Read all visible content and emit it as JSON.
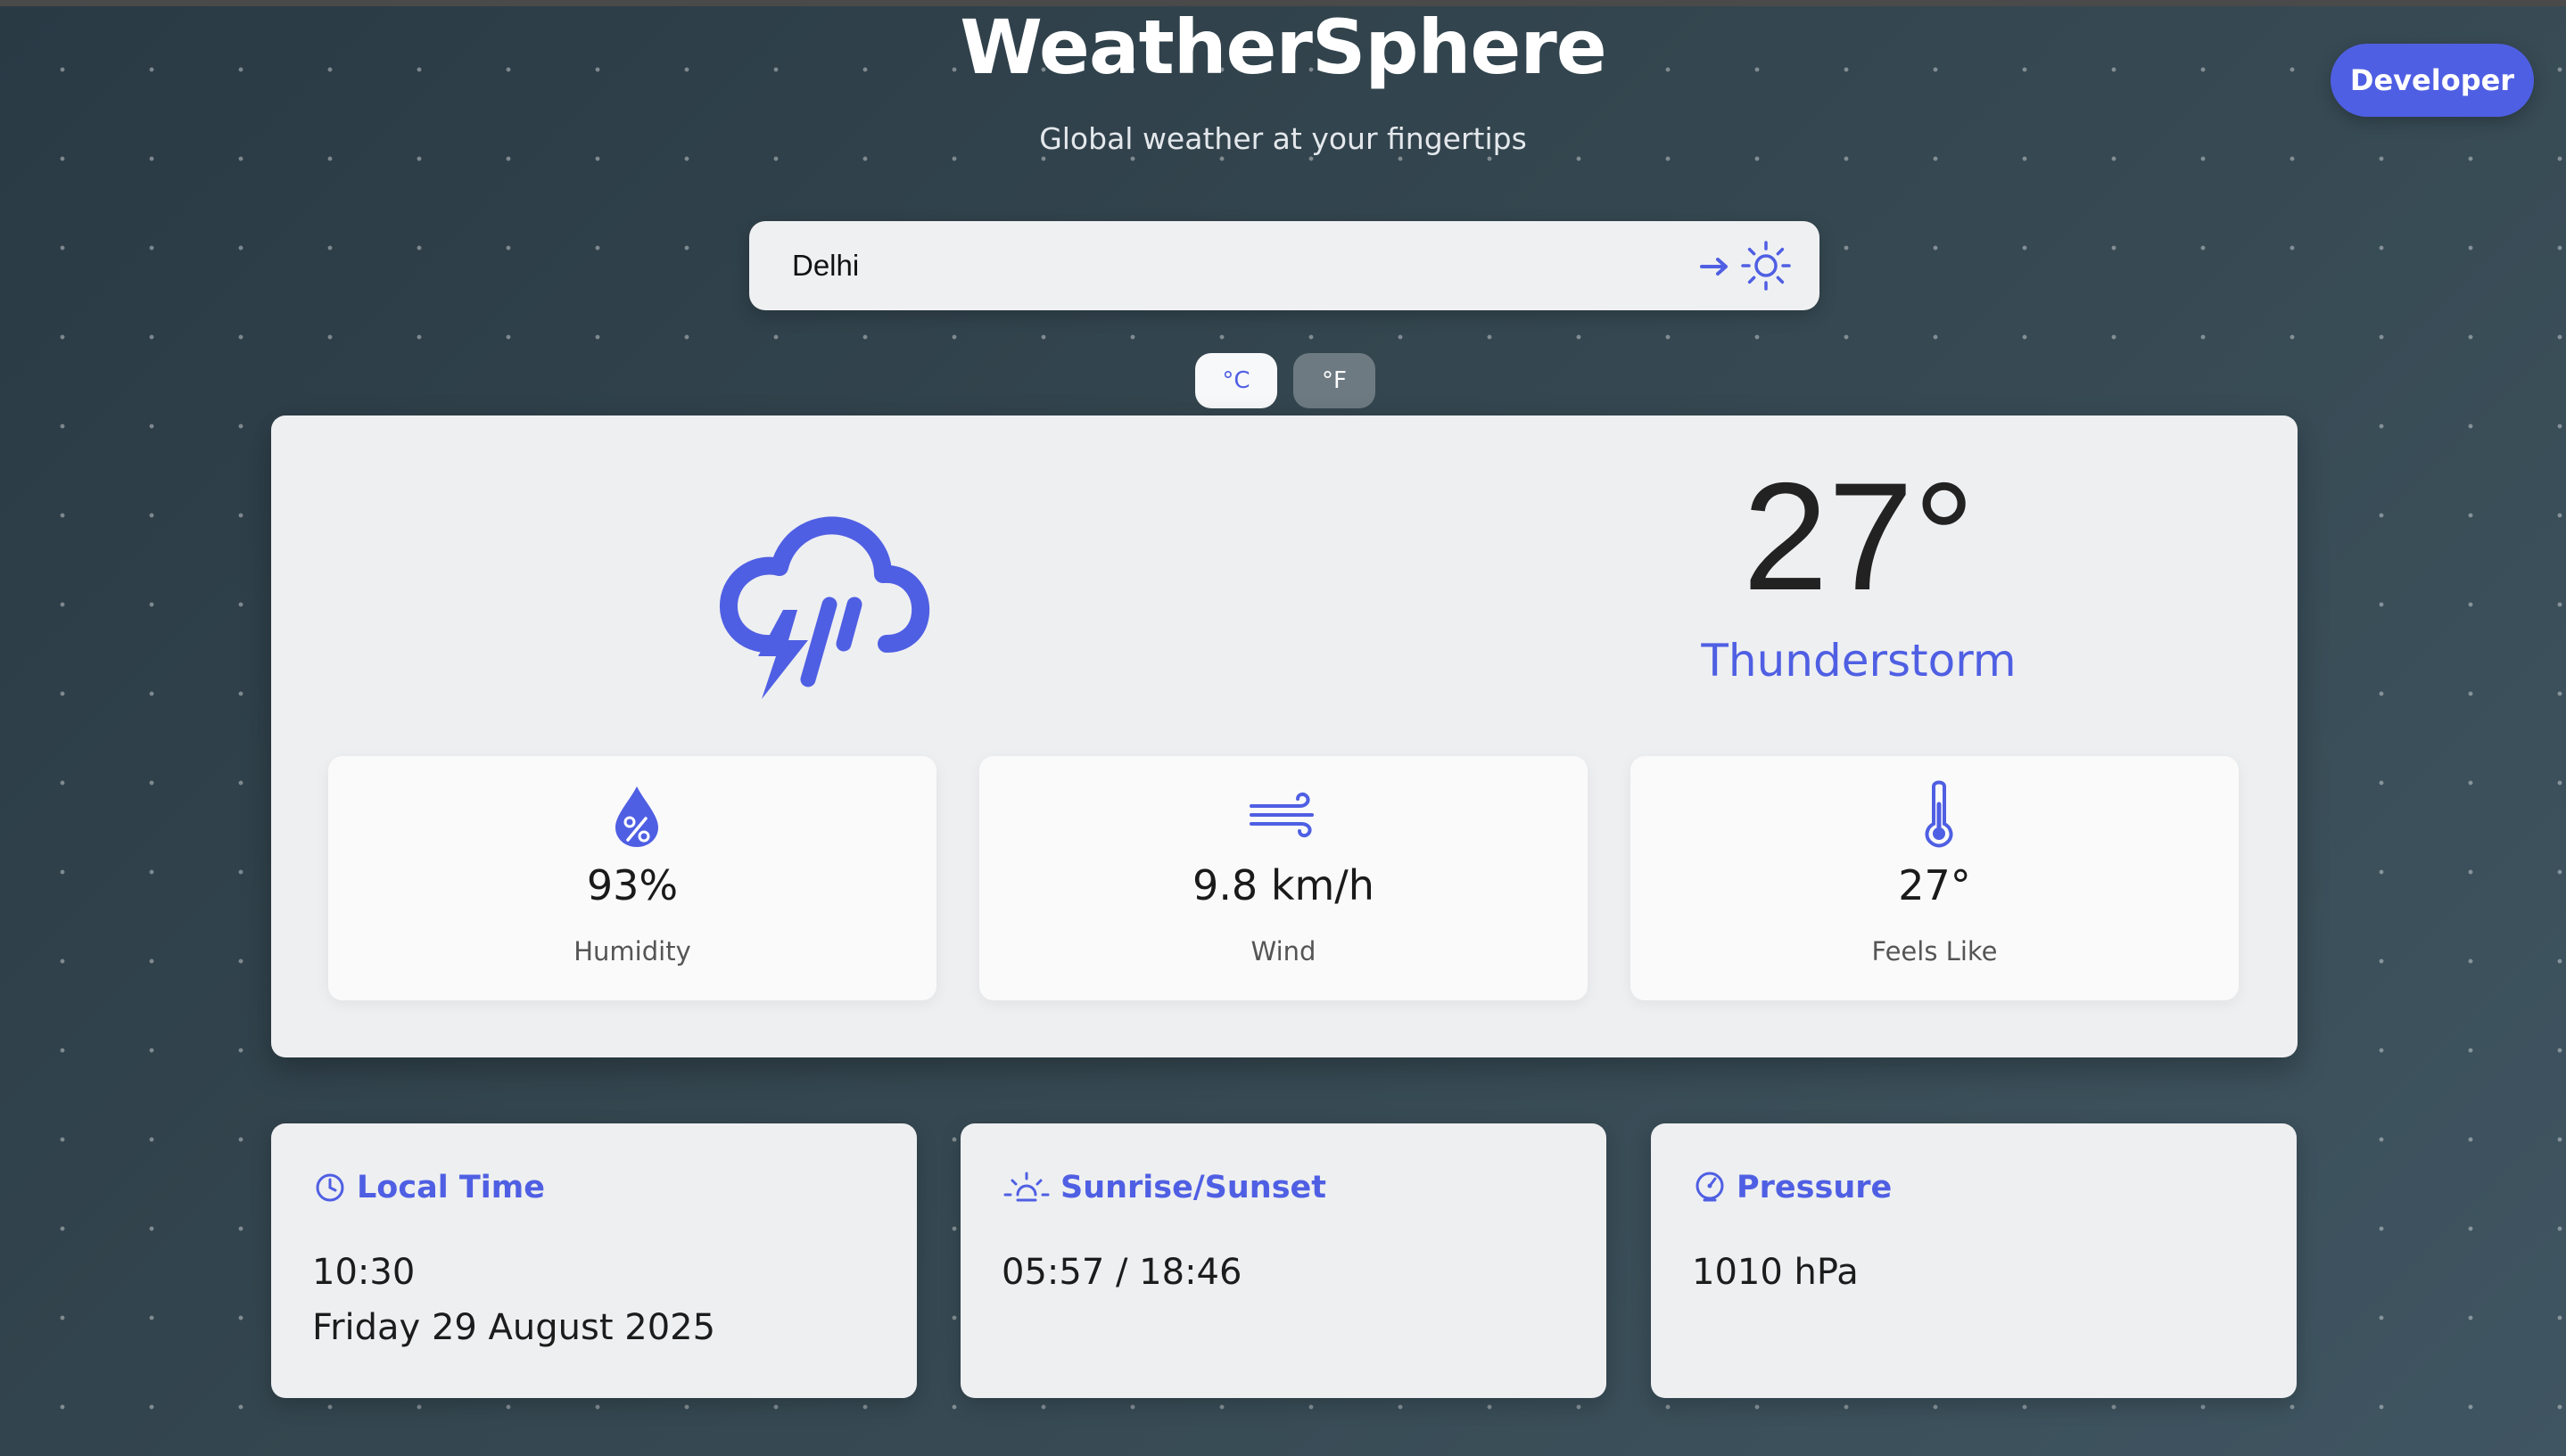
{
  "app": {
    "title": "WeatherSphere",
    "subtitle": "Global weather at your fingertips"
  },
  "header": {
    "developer_button": "Developer"
  },
  "search": {
    "value": "Delhi",
    "icons": [
      "arrow-right-icon",
      "sun-theme-icon"
    ]
  },
  "units": {
    "celsius": "°C",
    "fahrenheit": "°F",
    "selected": "°C"
  },
  "current": {
    "icon": "thunderstorm-icon",
    "temperature": "27°",
    "condition": "Thunderstorm",
    "stats": [
      {
        "icon": "humidity-drop-icon",
        "value": "93%",
        "label": "Humidity"
      },
      {
        "icon": "wind-icon",
        "value": "9.8 km/h",
        "label": "Wind"
      },
      {
        "icon": "thermometer-icon",
        "value": "27°",
        "label": "Feels Like"
      }
    ]
  },
  "details": {
    "local_time": {
      "icon": "clock-icon",
      "title": "Local Time",
      "time": "10:30",
      "date": "Friday 29 August 2025"
    },
    "sun": {
      "icon": "sunrise-icon",
      "title": "Sunrise/Sunset",
      "value": "05:57 / 18:46"
    },
    "pressure": {
      "icon": "pressure-gauge-icon",
      "title": "Pressure",
      "value": "1010 hPa"
    }
  },
  "colors": {
    "accent": "#4f5fe3",
    "card": "#eeeff1",
    "background": "#34464f"
  }
}
